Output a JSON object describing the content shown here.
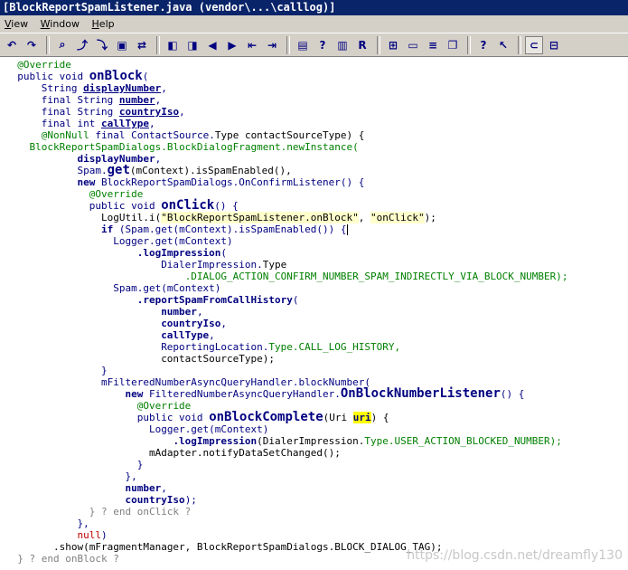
{
  "window": {
    "title": "[BlockReportSpamListener.java (vendor\\...\\calllog)]"
  },
  "menu": [
    "View",
    "Window",
    "Help"
  ],
  "toolbar": [
    {
      "icon": "undo-icon"
    },
    {
      "icon": "redo-icon"
    },
    {
      "sep": true
    },
    {
      "icon": "find-icon"
    },
    {
      "icon": "find-next-icon"
    },
    {
      "icon": "find-prev-icon"
    },
    {
      "icon": "find-in-files-icon"
    },
    {
      "icon": "replace-icon"
    },
    {
      "sep": true
    },
    {
      "icon": "bookmark-prev-icon"
    },
    {
      "icon": "bookmark-next-icon"
    },
    {
      "icon": "arrow-left-icon"
    },
    {
      "icon": "arrow-right-icon"
    },
    {
      "icon": "jump-back-icon"
    },
    {
      "icon": "jump-forward-icon"
    },
    {
      "sep": true
    },
    {
      "icon": "lock-icon"
    },
    {
      "icon": "help-icon"
    },
    {
      "icon": "book-icon"
    },
    {
      "icon": "r-icon"
    },
    {
      "sep": true
    },
    {
      "icon": "window-tile-icon"
    },
    {
      "icon": "window-split-icon"
    },
    {
      "icon": "window-stack-icon"
    },
    {
      "icon": "window-cascade-icon"
    },
    {
      "sep": true
    },
    {
      "icon": "context-help-icon"
    },
    {
      "icon": "pointer-help-icon"
    },
    {
      "sep": true
    },
    {
      "icon": "project-icon",
      "active": true
    },
    {
      "icon": "symbol-window-icon"
    }
  ],
  "code_lines": [
    [
      [
        "  ",
        ""
      ],
      [
        "@Override",
        "c-ann"
      ]
    ],
    [
      [
        "  ",
        ""
      ],
      [
        "public void ",
        "c-kw"
      ],
      [
        "onBlock",
        "c-fn"
      ],
      [
        "(",
        "c-kw"
      ]
    ],
    [
      [
        "      ",
        ""
      ],
      [
        "String ",
        "c-kw"
      ],
      [
        "displayNumber",
        "c-var"
      ],
      [
        ",",
        "c-kw"
      ]
    ],
    [
      [
        "      ",
        ""
      ],
      [
        "final String ",
        "c-kw"
      ],
      [
        "number",
        "c-var"
      ],
      [
        ",",
        "c-kw"
      ]
    ],
    [
      [
        "      ",
        ""
      ],
      [
        "final String ",
        "c-kw"
      ],
      [
        "countryIso",
        "c-var"
      ],
      [
        ",",
        "c-kw"
      ]
    ],
    [
      [
        "      ",
        ""
      ],
      [
        "final int ",
        "c-kw"
      ],
      [
        "callType",
        "c-var"
      ],
      [
        ",",
        "c-kw"
      ]
    ],
    [
      [
        "      ",
        ""
      ],
      [
        "@NonNull ",
        "c-ann"
      ],
      [
        "final ",
        "c-kw"
      ],
      [
        "ContactSource.",
        "c-kw"
      ],
      [
        "Type contactSourceType) {",
        ""
      ]
    ],
    [
      [
        "    ",
        ""
      ],
      [
        "BlockReportSpamDialogs.BlockDialogFragment.newInstance(",
        "c-green"
      ]
    ],
    [
      [
        "            ",
        ""
      ],
      [
        "displayNumber",
        "c-var2"
      ],
      [
        ",",
        "c-kw"
      ]
    ],
    [
      [
        "            ",
        ""
      ],
      [
        "Spam.",
        "c-kw"
      ],
      [
        "get",
        "c-fn"
      ],
      [
        "(mContext).isSpamEnabled(),",
        ""
      ]
    ],
    [
      [
        "            ",
        ""
      ],
      [
        "new ",
        "c-fnb"
      ],
      [
        "BlockReportSpamDialogs.OnConfirmListener() {",
        "c-kw"
      ]
    ],
    [
      [
        "              ",
        ""
      ],
      [
        "@Override",
        "c-ann"
      ]
    ],
    [
      [
        "              ",
        ""
      ],
      [
        "public void ",
        "c-kw"
      ],
      [
        "onClick",
        "c-fn"
      ],
      [
        "() {",
        "c-kw"
      ]
    ],
    [
      [
        "                ",
        ""
      ],
      [
        "LogUtil.i(",
        ""
      ],
      [
        "\"BlockReportSpamListener.onBlock\"",
        "c-str"
      ],
      [
        ", ",
        ""
      ],
      [
        "\"onClick\"",
        "c-str"
      ],
      [
        ");",
        ""
      ]
    ],
    [
      [
        "                ",
        ""
      ],
      [
        "if ",
        "c-fnb"
      ],
      [
        "(Spam.get(mContext).isSpamEnabled()) {",
        "c-kw"
      ],
      [
        "",
        "caret"
      ]
    ],
    [
      [
        "                  ",
        ""
      ],
      [
        "Logger.get(mContext)",
        "c-kw"
      ]
    ],
    [
      [
        "                      ",
        ""
      ],
      [
        ".logImpression",
        "c-fnb"
      ],
      [
        "(",
        "c-kw"
      ]
    ],
    [
      [
        "                          ",
        ""
      ],
      [
        "DialerImpression.",
        "c-kw"
      ],
      [
        "Type",
        ""
      ]
    ],
    [
      [
        "                              ",
        ""
      ],
      [
        ".DIALOG_ACTION_CONFIRM_NUMBER_SPAM_INDIRECTLY_VIA_BLOCK_NUMBER);",
        "c-const"
      ]
    ],
    [
      [
        "                  ",
        ""
      ],
      [
        "Spam.get(mContext)",
        "c-kw"
      ]
    ],
    [
      [
        "                      ",
        ""
      ],
      [
        ".reportSpamFromCallHistory",
        "c-fnb"
      ],
      [
        "(",
        "c-kw"
      ]
    ],
    [
      [
        "                          ",
        ""
      ],
      [
        "number",
        "c-var2"
      ],
      [
        ",",
        "c-kw"
      ]
    ],
    [
      [
        "                          ",
        ""
      ],
      [
        "countryIso",
        "c-var2"
      ],
      [
        ",",
        "c-kw"
      ]
    ],
    [
      [
        "                          ",
        ""
      ],
      [
        "callType",
        "c-var2"
      ],
      [
        ",",
        "c-kw"
      ]
    ],
    [
      [
        "                          ",
        ""
      ],
      [
        "ReportingLocation.",
        "c-kw"
      ],
      [
        "Type.CALL_LOG_HISTORY,",
        "c-const"
      ]
    ],
    [
      [
        "                          ",
        ""
      ],
      [
        "contactSourceType);",
        ""
      ]
    ],
    [
      [
        "                ",
        ""
      ],
      [
        "}",
        "c-kw"
      ]
    ],
    [
      [
        "                ",
        ""
      ],
      [
        "mFilteredNumberAsyncQueryHandler.blockNumber(",
        "c-kw"
      ]
    ],
    [
      [
        "                    ",
        ""
      ],
      [
        "new ",
        "c-fnb"
      ],
      [
        "FilteredNumberAsyncQueryHandler.",
        "c-kw"
      ],
      [
        "OnBlockNumberListener",
        "c-fn"
      ],
      [
        "() {",
        "c-kw"
      ]
    ],
    [
      [
        "                      ",
        ""
      ],
      [
        "@Override",
        "c-ann"
      ]
    ],
    [
      [
        "                      ",
        ""
      ],
      [
        "public void ",
        "c-kw"
      ],
      [
        "onBlockComplete",
        "c-fn"
      ],
      [
        "(Uri ",
        ""
      ],
      [
        "uri",
        "c-hl"
      ],
      [
        ") {",
        ""
      ]
    ],
    [
      [
        "                        ",
        ""
      ],
      [
        "Logger.get(mContext)",
        "c-kw"
      ]
    ],
    [
      [
        "                            ",
        ""
      ],
      [
        ".logImpression",
        "c-fnb"
      ],
      [
        "(DialerImpression.",
        ""
      ],
      [
        "Type.USER_ACTION_BLOCKED_NUMBER);",
        "c-const"
      ]
    ],
    [
      [
        "                        ",
        ""
      ],
      [
        "mAdapter.notifyDataSetChanged();",
        ""
      ]
    ],
    [
      [
        "                      ",
        ""
      ],
      [
        "}",
        "c-kw"
      ]
    ],
    [
      [
        "                    ",
        ""
      ],
      [
        "},",
        "c-kw"
      ]
    ],
    [
      [
        "                    ",
        ""
      ],
      [
        "number",
        "c-var2"
      ],
      [
        ",",
        "c-kw"
      ]
    ],
    [
      [
        "                    ",
        ""
      ],
      [
        "countryIso",
        "c-var2"
      ],
      [
        ");",
        "c-kw"
      ]
    ],
    [
      [
        "              ",
        ""
      ],
      [
        "} ? end onClick ?",
        "c-cmt"
      ]
    ],
    [
      [
        "            ",
        ""
      ],
      [
        "},",
        "c-kw"
      ]
    ],
    [
      [
        "            ",
        ""
      ],
      [
        "null",
        "c-red"
      ],
      [
        ")",
        "c-kw"
      ]
    ],
    [
      [
        "        ",
        ""
      ],
      [
        ".show(mFragmentManager, BlockReportSpamDialogs.BLOCK_DIALOG_TAG);",
        ""
      ]
    ],
    [
      [
        "  ",
        ""
      ],
      [
        "} ? end onBlock ?",
        "c-cmt"
      ]
    ]
  ],
  "watermark": "https://blog.csdn.net/dreamfly130"
}
